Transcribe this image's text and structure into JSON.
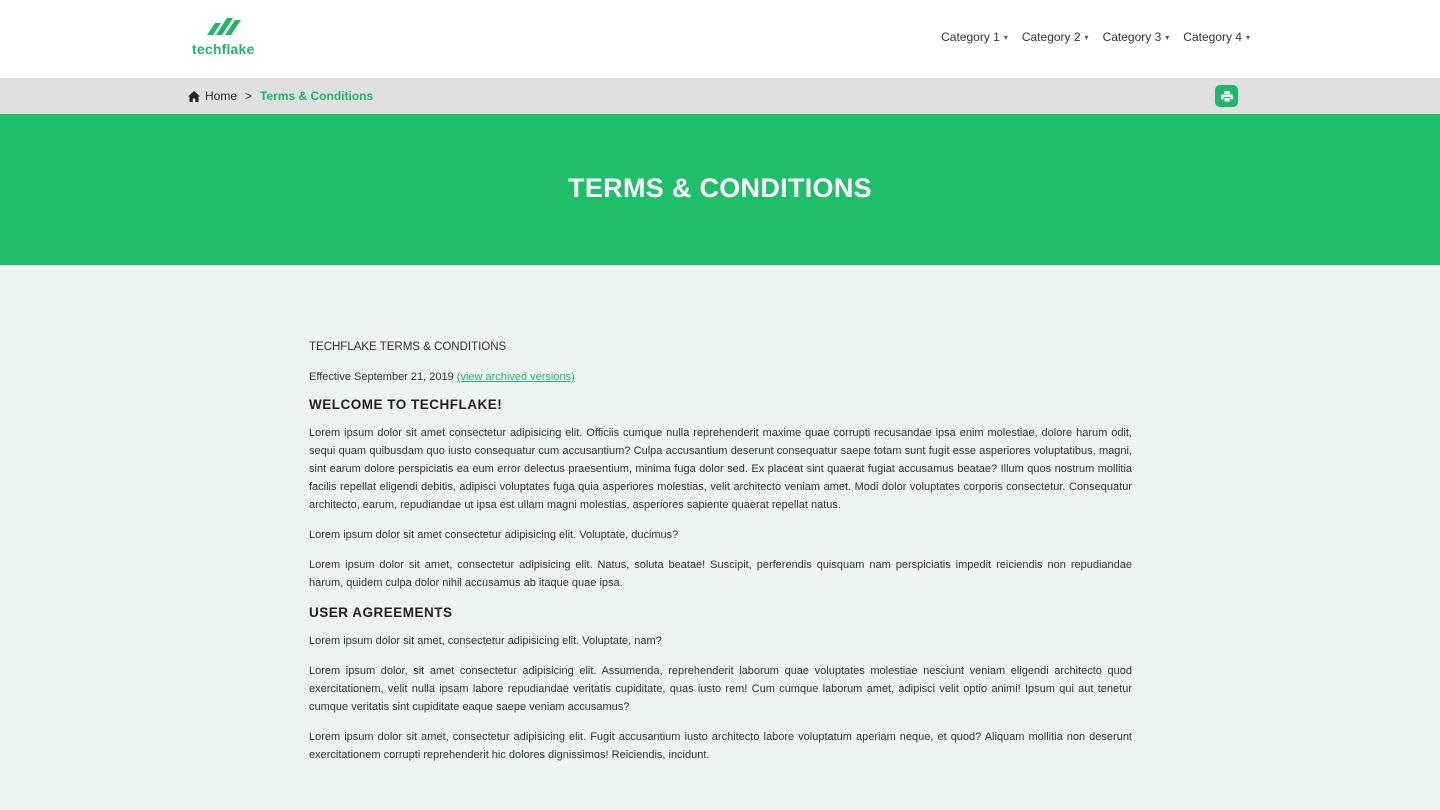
{
  "header": {
    "logo_text": "techflake",
    "nav": [
      {
        "label": "Category 1"
      },
      {
        "label": "Category 2"
      },
      {
        "label": "Category 3"
      },
      {
        "label": "Category 4"
      }
    ]
  },
  "breadcrumb": {
    "home": "Home",
    "separator": ">",
    "current": "Terms & Conditions"
  },
  "hero": {
    "title": "TERMS & CONDITIONS"
  },
  "content": {
    "doc_title": "TECHFLAKE TERMS & CONDITIONS",
    "effective_text": "Effective September 21, 2019 ",
    "effective_link": "(view archived versions)",
    "welcome_heading": "WELCOME TO TECHFLAKE!",
    "welcome_paragraphs": [
      "Lorem ipsum dolor sit amet consectetur adipisicing elit. Officiis cumque nulla reprehenderit maxime quae corrupti recusandae ipsa enim molestiae, dolore harum odit, sequi quam quibusdam quo iusto consequatur cum accusantium? Culpa accusantium deserunt consequatur saepe totam sunt fugit esse asperiores voluptatibus, magni, sint earum dolore perspiciatis ea eum error delectus praesentium, minima fuga dolor sed. Ex placeat sint quaerat fugiat accusamus beatae? Illum quos nostrum mollitia facilis repellat eligendi debitis, adipisci voluptates fuga quia asperiores molestias, velit architecto veniam amet. Modi dolor voluptates corporis consectetur. Consequatur architecto, earum, repudiandae ut ipsa est ullam magni molestias, asperiores sapiente quaerat repellat natus.",
      "Lorem ipsum dolor sit amet consectetur adipisicing elit. Voluptate, ducimus?",
      "Lorem ipsum dolor sit amet, consectetur adipisicing elit. Natus, soluta beatae! Suscipit, perferendis quisquam nam perspiciatis impedit reiciendis non repudiandae harum, quidem culpa dolor nihil accusamus ab itaque quae ipsa."
    ],
    "user_heading": "USER AGREEMENTS",
    "user_paragraphs": [
      "Lorem ipsum dolor sit amet, consectetur adipisicing elit. Voluptate, nam?",
      "Lorem ipsum dolor, sit amet consectetur adipisicing elit. Assumenda, reprehenderit laborum quae voluptates molestiae nesciunt veniam eligendi architecto quod exercitationem, velit nulla ipsam labore repudiandae veritatis cupiditate, quas iusto rem! Cum cumque laborum amet, adipisci velit optio animi! Ipsum qui aut tenetur cumque veritatis sint cupiditate eaque saepe veniam accusamus?",
      "Lorem ipsum dolor sit amet, consectetur adipisicing elit. Fugit accusantium iusto architecto labore voluptatum aperiam neque, et quod? Aliquam mollitia non deserunt exercitationem corrupti reprehenderit hic dolores dignissimos! Reiciendis, incidunt."
    ]
  },
  "colors": {
    "brand_green": "#1fbe68",
    "link_green": "#1fb765",
    "breadcrumb_bg": "#e0e0e0",
    "content_bg": "#eff3f3"
  },
  "icons": {
    "logo": "techflake-logo-icon",
    "home": "home-icon",
    "print": "print-icon",
    "caret": "caret-down-icon"
  }
}
